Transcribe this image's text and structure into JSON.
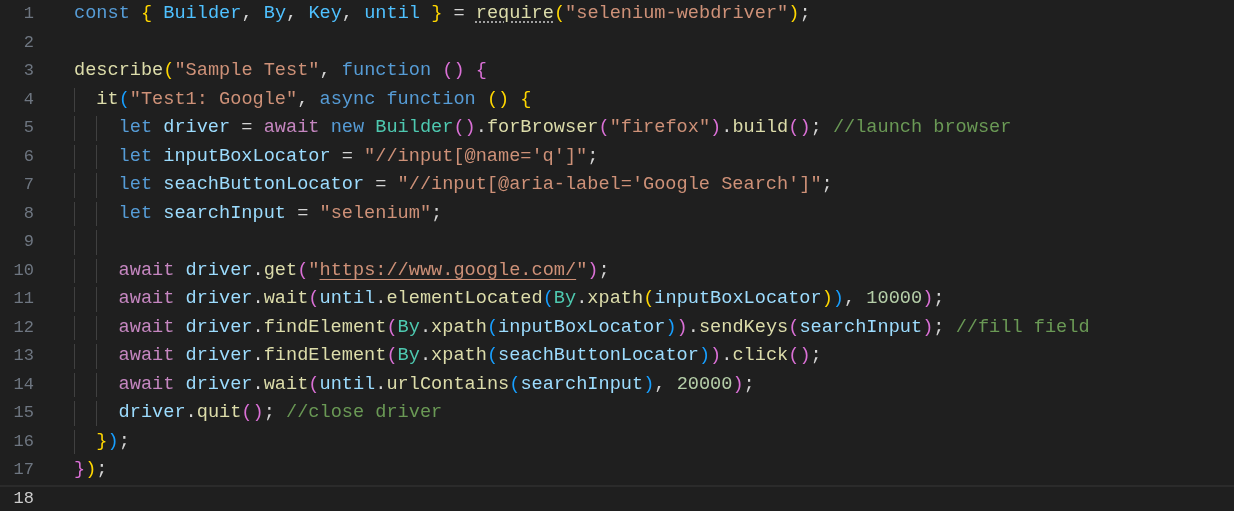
{
  "editor": {
    "lines": [
      {
        "number": "1",
        "current": false,
        "tokens": [
          {
            "kind": "kw",
            "text": "const "
          },
          {
            "kind": "b1",
            "text": "{"
          },
          {
            "kind": "c",
            "text": " Builder"
          },
          {
            "kind": "p",
            "text": ","
          },
          {
            "kind": "c",
            "text": " By"
          },
          {
            "kind": "p",
            "text": ","
          },
          {
            "kind": "c",
            "text": " Key"
          },
          {
            "kind": "p",
            "text": ","
          },
          {
            "kind": "c",
            "text": " until "
          },
          {
            "kind": "b1",
            "text": "}"
          },
          {
            "kind": "p",
            "text": " = "
          },
          {
            "kind": "fnh",
            "text": "require"
          },
          {
            "kind": "b1",
            "text": "("
          },
          {
            "kind": "s",
            "text": "\"selenium-webdriver\""
          },
          {
            "kind": "b1",
            "text": ")"
          },
          {
            "kind": "p",
            "text": ";"
          }
        ]
      },
      {
        "number": "2",
        "current": false
      },
      {
        "number": "3",
        "current": false,
        "tokens": [
          {
            "kind": "fn",
            "text": "describe"
          },
          {
            "kind": "b1",
            "text": "("
          },
          {
            "kind": "s",
            "text": "\"Sample Test\""
          },
          {
            "kind": "p",
            "text": ", "
          },
          {
            "kind": "kw",
            "text": "function "
          },
          {
            "kind": "b2",
            "text": "()"
          },
          {
            "kind": "b2",
            "text": " {"
          }
        ],
        "children": [
          {
            "number": "4",
            "current": false,
            "tokens": [
              {
                "kind": "fn",
                "text": "it"
              },
              {
                "kind": "b3",
                "text": "("
              },
              {
                "kind": "s",
                "text": "\"Test1: Google\""
              },
              {
                "kind": "p",
                "text": ", "
              },
              {
                "kind": "kw",
                "text": "async function "
              },
              {
                "kind": "b1",
                "text": "()"
              },
              {
                "kind": "b1",
                "text": " {"
              }
            ],
            "children": [
              {
                "number": "5",
                "current": false,
                "tokens": [
                  {
                    "kind": "kw",
                    "text": "let "
                  },
                  {
                    "kind": "v",
                    "text": "driver"
                  },
                  {
                    "kind": "p",
                    "text": " = "
                  },
                  {
                    "kind": "ctrl",
                    "text": "await "
                  },
                  {
                    "kind": "kw",
                    "text": "new "
                  },
                  {
                    "kind": "ty",
                    "text": "Builder"
                  },
                  {
                    "kind": "b2",
                    "text": "()"
                  },
                  {
                    "kind": "p",
                    "text": "."
                  },
                  {
                    "kind": "fn",
                    "text": "forBrowser"
                  },
                  {
                    "kind": "b2",
                    "text": "("
                  },
                  {
                    "kind": "s",
                    "text": "\"firefox\""
                  },
                  {
                    "kind": "b2",
                    "text": ")"
                  },
                  {
                    "kind": "p",
                    "text": "."
                  },
                  {
                    "kind": "fn",
                    "text": "build"
                  },
                  {
                    "kind": "b2",
                    "text": "()"
                  },
                  {
                    "kind": "p",
                    "text": "; "
                  },
                  {
                    "kind": "cm",
                    "text": "//launch browser"
                  }
                ]
              },
              {
                "number": "6",
                "current": false,
                "tokens": [
                  {
                    "kind": "kw",
                    "text": "let "
                  },
                  {
                    "kind": "v",
                    "text": "inputBoxLocator"
                  },
                  {
                    "kind": "p",
                    "text": " = "
                  },
                  {
                    "kind": "s",
                    "text": "\"//input[@name='q']\""
                  },
                  {
                    "kind": "p",
                    "text": ";"
                  }
                ]
              },
              {
                "number": "7",
                "current": false,
                "tokens": [
                  {
                    "kind": "kw",
                    "text": "let "
                  },
                  {
                    "kind": "v",
                    "text": "seachButtonLocator"
                  },
                  {
                    "kind": "p",
                    "text": " = "
                  },
                  {
                    "kind": "s",
                    "text": "\"//input[@aria-label='Google Search']\""
                  },
                  {
                    "kind": "p",
                    "text": ";"
                  }
                ]
              },
              {
                "number": "8",
                "current": false,
                "tokens": [
                  {
                    "kind": "kw",
                    "text": "let "
                  },
                  {
                    "kind": "v",
                    "text": "searchInput"
                  },
                  {
                    "kind": "p",
                    "text": " = "
                  },
                  {
                    "kind": "s",
                    "text": "\"selenium\""
                  },
                  {
                    "kind": "p",
                    "text": ";"
                  }
                ]
              },
              {
                "number": "9",
                "current": false
              },
              {
                "number": "10",
                "current": false,
                "tokens": [
                  {
                    "kind": "ctrl",
                    "text": "await "
                  },
                  {
                    "kind": "v",
                    "text": "driver"
                  },
                  {
                    "kind": "p",
                    "text": "."
                  },
                  {
                    "kind": "fn",
                    "text": "get"
                  },
                  {
                    "kind": "b2",
                    "text": "("
                  },
                  {
                    "kind": "s",
                    "text": "\""
                  },
                  {
                    "kind": "link",
                    "text": "https://www.google.com/"
                  },
                  {
                    "kind": "s",
                    "text": "\""
                  },
                  {
                    "kind": "b2",
                    "text": ")"
                  },
                  {
                    "kind": "p",
                    "text": ";"
                  }
                ]
              },
              {
                "number": "11",
                "current": false,
                "tokens": [
                  {
                    "kind": "ctrl",
                    "text": "await "
                  },
                  {
                    "kind": "v",
                    "text": "driver"
                  },
                  {
                    "kind": "p",
                    "text": "."
                  },
                  {
                    "kind": "fn",
                    "text": "wait"
                  },
                  {
                    "kind": "b2",
                    "text": "("
                  },
                  {
                    "kind": "v",
                    "text": "until"
                  },
                  {
                    "kind": "p",
                    "text": "."
                  },
                  {
                    "kind": "fn",
                    "text": "elementLocated"
                  },
                  {
                    "kind": "b3",
                    "text": "("
                  },
                  {
                    "kind": "ty",
                    "text": "By"
                  },
                  {
                    "kind": "p",
                    "text": "."
                  },
                  {
                    "kind": "fn",
                    "text": "xpath"
                  },
                  {
                    "kind": "b1",
                    "text": "("
                  },
                  {
                    "kind": "v",
                    "text": "inputBoxLocator"
                  },
                  {
                    "kind": "b1",
                    "text": ")"
                  },
                  {
                    "kind": "b3",
                    "text": ")"
                  },
                  {
                    "kind": "p",
                    "text": ", "
                  },
                  {
                    "kind": "n",
                    "text": "10000"
                  },
                  {
                    "kind": "b2",
                    "text": ")"
                  },
                  {
                    "kind": "p",
                    "text": ";"
                  }
                ]
              },
              {
                "number": "12",
                "current": false,
                "tokens": [
                  {
                    "kind": "ctrl",
                    "text": "await "
                  },
                  {
                    "kind": "v",
                    "text": "driver"
                  },
                  {
                    "kind": "p",
                    "text": "."
                  },
                  {
                    "kind": "fn",
                    "text": "findElement"
                  },
                  {
                    "kind": "b2",
                    "text": "("
                  },
                  {
                    "kind": "ty",
                    "text": "By"
                  },
                  {
                    "kind": "p",
                    "text": "."
                  },
                  {
                    "kind": "fn",
                    "text": "xpath"
                  },
                  {
                    "kind": "b3",
                    "text": "("
                  },
                  {
                    "kind": "v",
                    "text": "inputBoxLocator"
                  },
                  {
                    "kind": "b3",
                    "text": ")"
                  },
                  {
                    "kind": "b2",
                    "text": ")"
                  },
                  {
                    "kind": "p",
                    "text": "."
                  },
                  {
                    "kind": "fn",
                    "text": "sendKeys"
                  },
                  {
                    "kind": "b2",
                    "text": "("
                  },
                  {
                    "kind": "v",
                    "text": "searchInput"
                  },
                  {
                    "kind": "b2",
                    "text": ")"
                  },
                  {
                    "kind": "p",
                    "text": "; "
                  },
                  {
                    "kind": "cm",
                    "text": "//fill field"
                  }
                ]
              },
              {
                "number": "13",
                "current": false,
                "tokens": [
                  {
                    "kind": "ctrl",
                    "text": "await "
                  },
                  {
                    "kind": "v",
                    "text": "driver"
                  },
                  {
                    "kind": "p",
                    "text": "."
                  },
                  {
                    "kind": "fn",
                    "text": "findElement"
                  },
                  {
                    "kind": "b2",
                    "text": "("
                  },
                  {
                    "kind": "ty",
                    "text": "By"
                  },
                  {
                    "kind": "p",
                    "text": "."
                  },
                  {
                    "kind": "fn",
                    "text": "xpath"
                  },
                  {
                    "kind": "b3",
                    "text": "("
                  },
                  {
                    "kind": "v",
                    "text": "seachButtonLocator"
                  },
                  {
                    "kind": "b3",
                    "text": ")"
                  },
                  {
                    "kind": "b2",
                    "text": ")"
                  },
                  {
                    "kind": "p",
                    "text": "."
                  },
                  {
                    "kind": "fn",
                    "text": "click"
                  },
                  {
                    "kind": "b2",
                    "text": "()"
                  },
                  {
                    "kind": "p",
                    "text": ";"
                  }
                ]
              },
              {
                "number": "14",
                "current": false,
                "tokens": [
                  {
                    "kind": "ctrl",
                    "text": "await "
                  },
                  {
                    "kind": "v",
                    "text": "driver"
                  },
                  {
                    "kind": "p",
                    "text": "."
                  },
                  {
                    "kind": "fn",
                    "text": "wait"
                  },
                  {
                    "kind": "b2",
                    "text": "("
                  },
                  {
                    "kind": "v",
                    "text": "until"
                  },
                  {
                    "kind": "p",
                    "text": "."
                  },
                  {
                    "kind": "fn",
                    "text": "urlContains"
                  },
                  {
                    "kind": "b3",
                    "text": "("
                  },
                  {
                    "kind": "v",
                    "text": "searchInput"
                  },
                  {
                    "kind": "b3",
                    "text": ")"
                  },
                  {
                    "kind": "p",
                    "text": ", "
                  },
                  {
                    "kind": "n",
                    "text": "20000"
                  },
                  {
                    "kind": "b2",
                    "text": ")"
                  },
                  {
                    "kind": "p",
                    "text": ";"
                  }
                ]
              },
              {
                "number": "15",
                "current": false,
                "tokens": [
                  {
                    "kind": "v",
                    "text": "driver"
                  },
                  {
                    "kind": "p",
                    "text": "."
                  },
                  {
                    "kind": "fn",
                    "text": "quit"
                  },
                  {
                    "kind": "b2",
                    "text": "()"
                  },
                  {
                    "kind": "p",
                    "text": "; "
                  },
                  {
                    "kind": "cm",
                    "text": "//close driver"
                  }
                ]
              }
            ]
          },
          {
            "number": "16",
            "current": false,
            "tokens": [
              {
                "kind": "b1",
                "text": "}"
              },
              {
                "kind": "b3",
                "text": ")"
              },
              {
                "kind": "p",
                "text": ";"
              }
            ]
          }
        ]
      },
      {
        "number": "17",
        "current": false,
        "tokens": [
          {
            "kind": "b2",
            "text": "}"
          },
          {
            "kind": "b1",
            "text": ")"
          },
          {
            "kind": "p",
            "text": ";"
          }
        ]
      },
      {
        "number": "18",
        "current": true
      }
    ]
  }
}
